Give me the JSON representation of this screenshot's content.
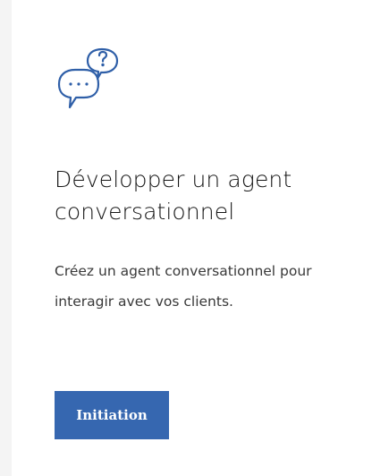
{
  "card": {
    "icon": "chat-question-icon",
    "title": "Développer un agent conversationnel",
    "description": "Créez un agent conversationnel pour interagir avec vos clients.",
    "button_label": "Initiation"
  },
  "colors": {
    "background": "#f4f4f4",
    "card": "#ffffff",
    "accent": "#3667b0",
    "icon_stroke": "#2f5fa8",
    "text_primary": "#161616",
    "text_secondary": "#393939"
  }
}
